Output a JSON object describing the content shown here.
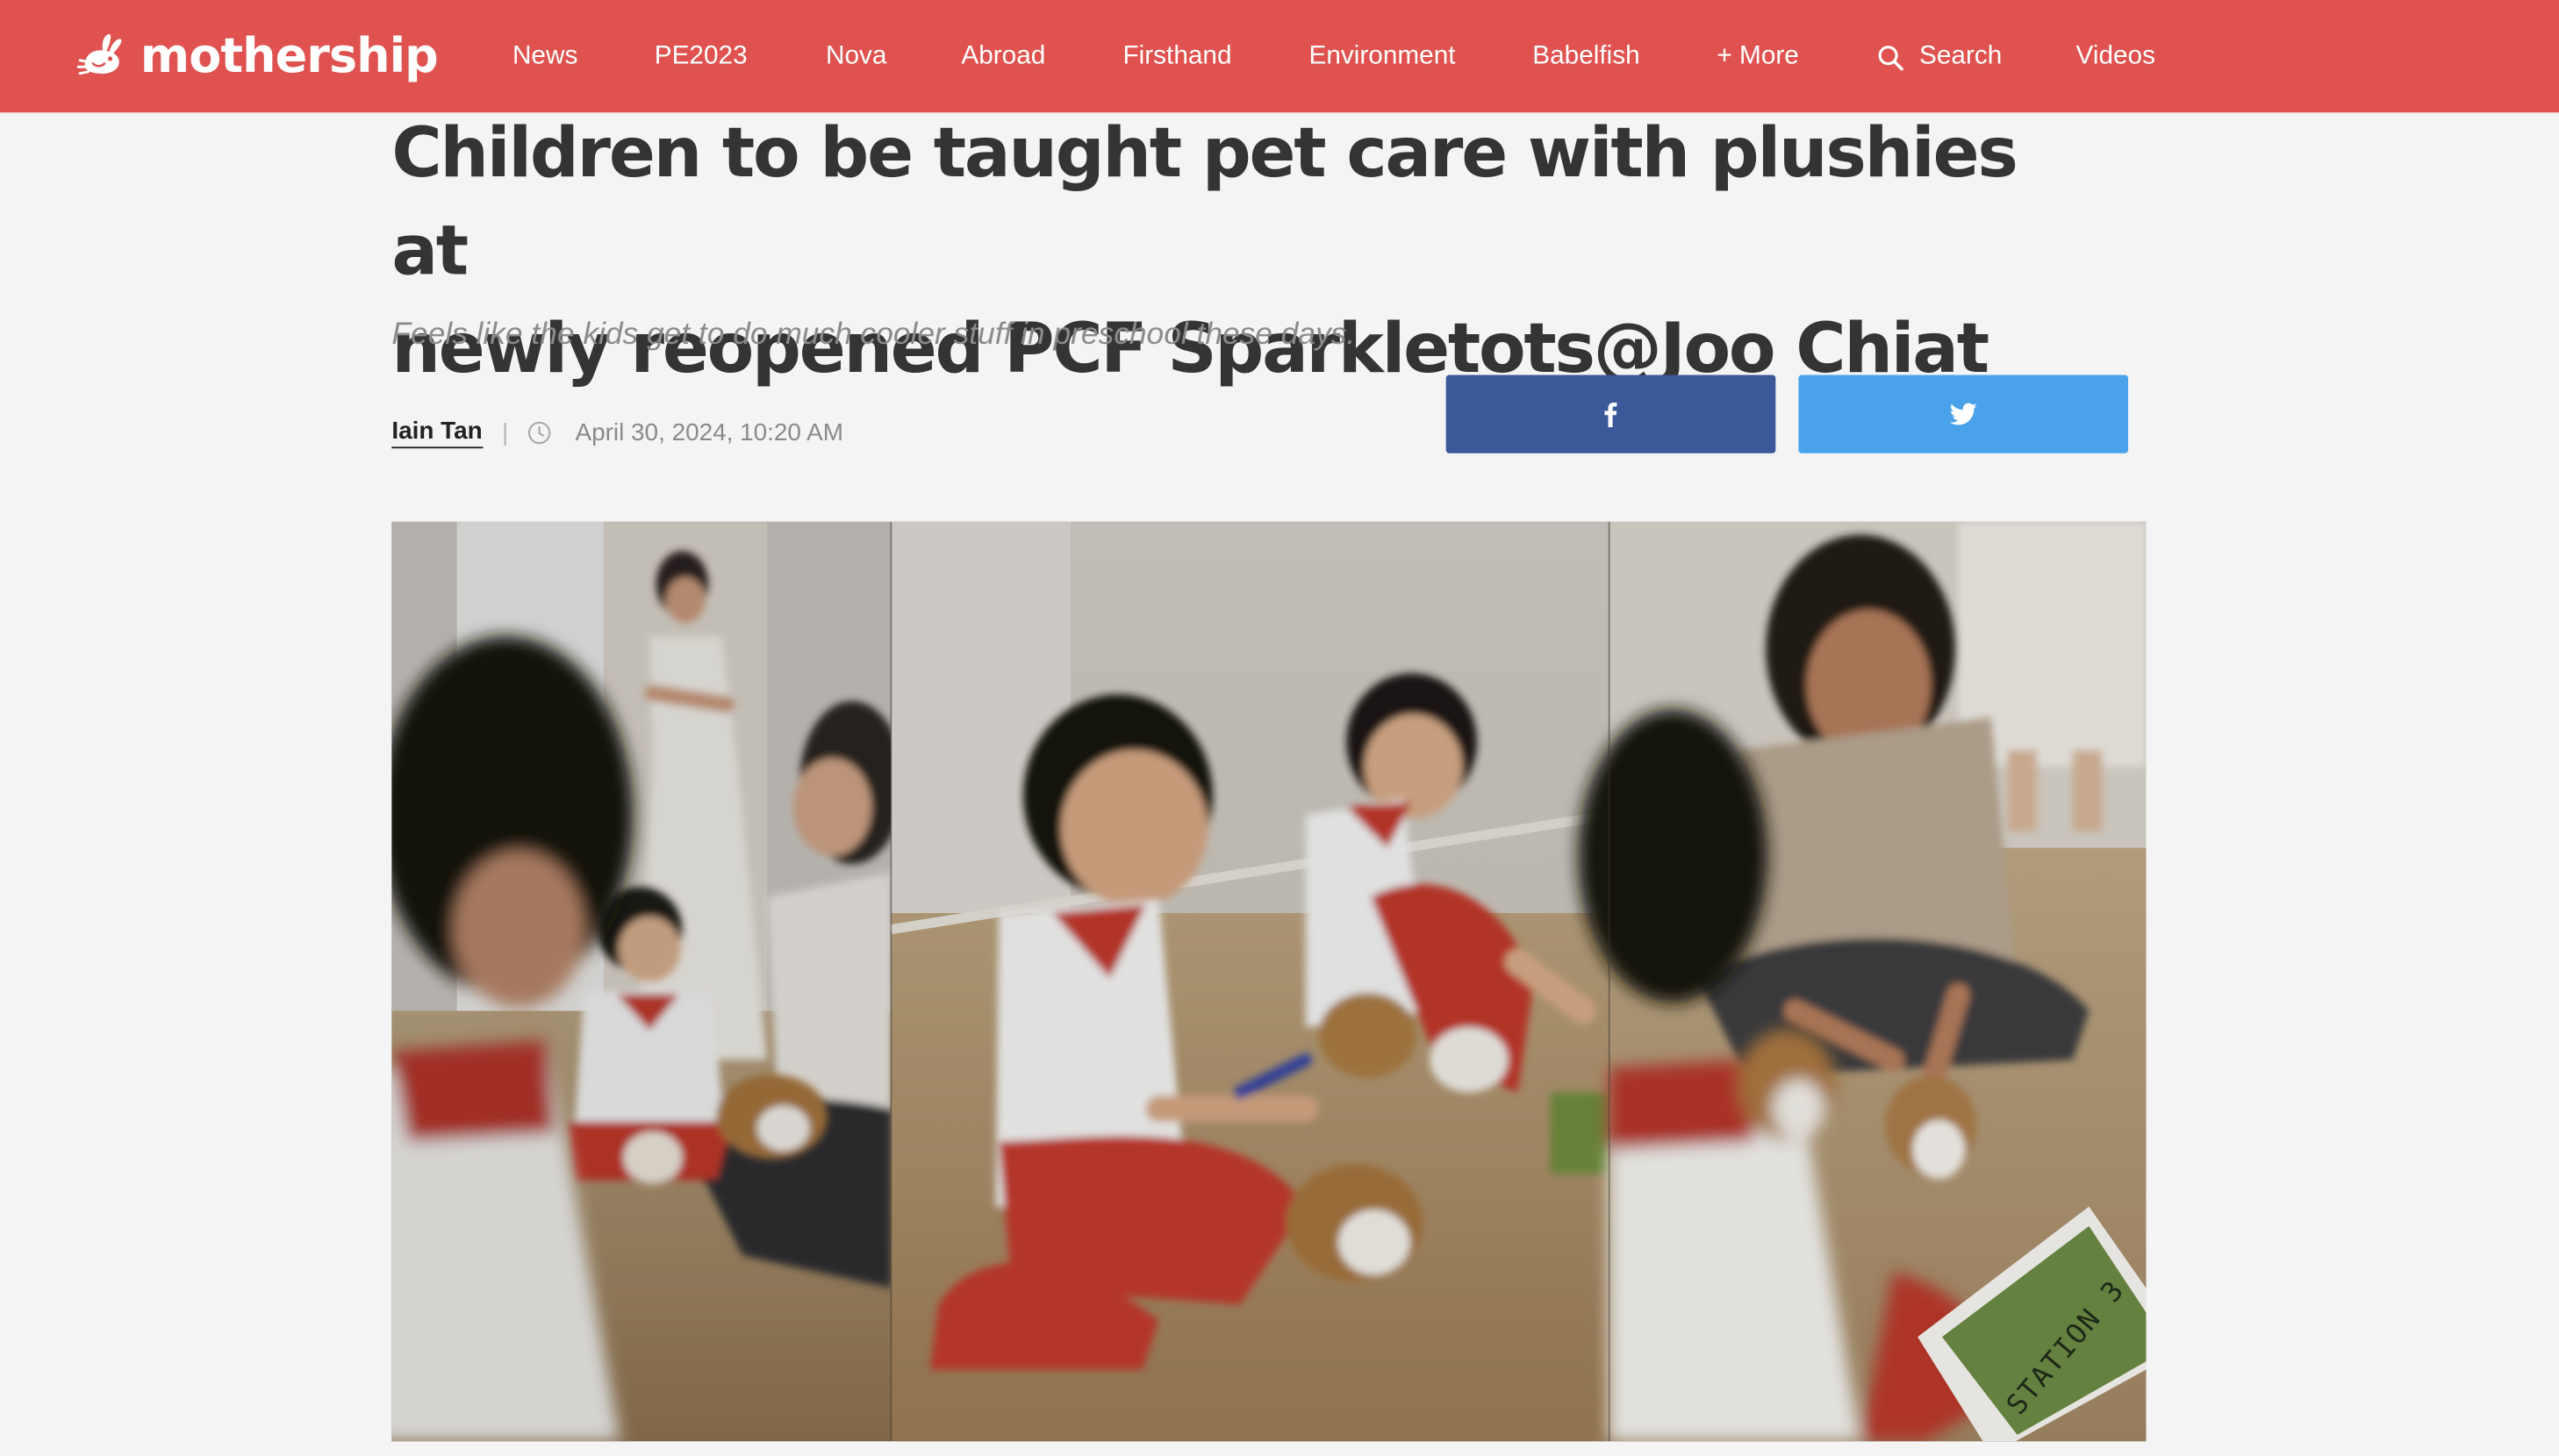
{
  "brand": {
    "name": "mothership",
    "logo_icon": "rabbit-mascot-icon",
    "color": "#df524f"
  },
  "nav": {
    "items": [
      "News",
      "PE2023",
      "Nova",
      "Abroad",
      "Firsthand",
      "Environment",
      "Babelfish",
      "+ More"
    ],
    "search_label": "Search",
    "search_icon": "search-icon",
    "videos_label": "Videos"
  },
  "article": {
    "headline_line1": "Children to be taught pet care with plushies at",
    "headline_line2": "newly reopened PCF Sparkletots@Joo Chiat",
    "subtitle": "Feels like the kids get to do much cooler stuff in preschool these days.",
    "author": "Iain Tan",
    "separator": "|",
    "date": "April 30, 2024, 10:20 AM",
    "date_icon": "clock-icon"
  },
  "share": {
    "facebook_icon": "facebook-icon",
    "facebook_color": "#3b5998",
    "twitter_icon": "twitter-icon",
    "twitter_color": "#4aa3ea"
  },
  "hero_image": {
    "sign_text": "STATION 3"
  }
}
